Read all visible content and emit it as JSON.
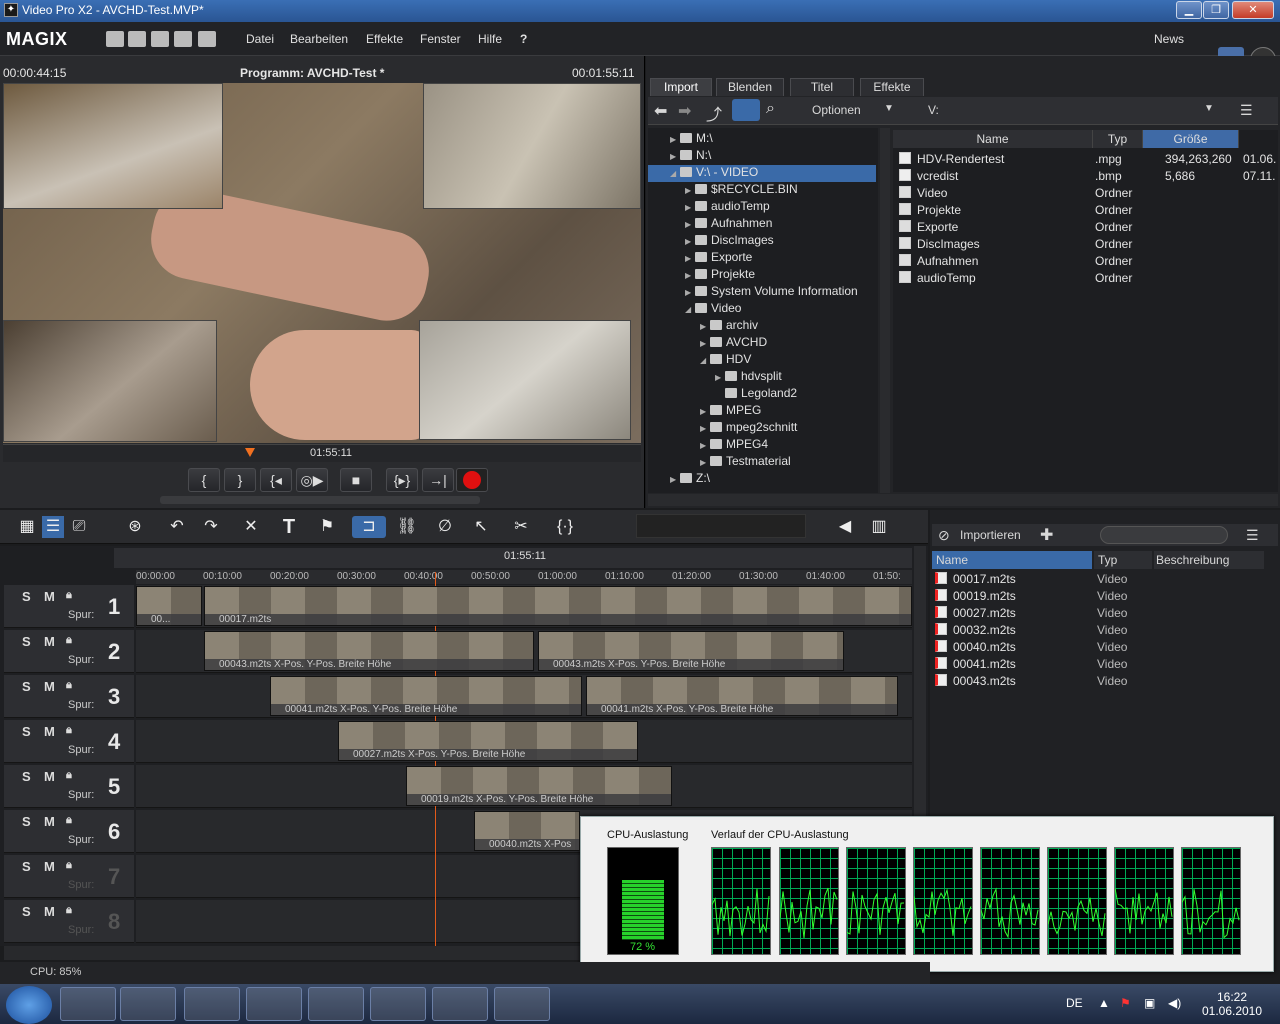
{
  "window": {
    "title": "Video Pro X2 - AVCHD-Test.MVP*",
    "minimize": "▁",
    "maximize": "❐",
    "close": "✕"
  },
  "menubar": {
    "logo": "MAGIX",
    "items": [
      "Datei",
      "Bearbeiten",
      "Effekte",
      "Fenster",
      "Hilfe"
    ],
    "help_icon": "?",
    "news": "News"
  },
  "preview": {
    "time_left": "00:00:44:15",
    "title": "Programm: AVCHD-Test *",
    "time_right": "00:01:55:11",
    "scrub_time": "01:55:11",
    "transport": [
      "{",
      "}",
      "{◂",
      "◎▶",
      "■",
      "{▸}",
      "→|"
    ]
  },
  "browser": {
    "tabs": [
      "Import",
      "Blenden",
      "Titel",
      "Effekte"
    ],
    "options": "Optionen",
    "path": "V:",
    "tree": [
      {
        "label": "M:\\",
        "level": 0,
        "arrow": "▶"
      },
      {
        "label": "N:\\",
        "level": 0,
        "arrow": "▶"
      },
      {
        "label": "V:\\ - VIDEO",
        "level": 0,
        "arrow": "◢"
      },
      {
        "label": "$RECYCLE.BIN",
        "level": 1,
        "arrow": "▶"
      },
      {
        "label": "audioTemp",
        "level": 1,
        "arrow": "▶"
      },
      {
        "label": "Aufnahmen",
        "level": 1,
        "arrow": "▶"
      },
      {
        "label": "DiscImages",
        "level": 1,
        "arrow": "▶"
      },
      {
        "label": "Exporte",
        "level": 1,
        "arrow": "▶"
      },
      {
        "label": "Projekte",
        "level": 1,
        "arrow": "▶"
      },
      {
        "label": "System Volume Information",
        "level": 1,
        "arrow": "▶"
      },
      {
        "label": "Video",
        "level": 1,
        "arrow": "◢"
      },
      {
        "label": "archiv",
        "level": 2,
        "arrow": "▶"
      },
      {
        "label": "AVCHD",
        "level": 2,
        "arrow": "▶"
      },
      {
        "label": "HDV",
        "level": 2,
        "arrow": "◢"
      },
      {
        "label": "hdvsplit",
        "level": 3,
        "arrow": "▶"
      },
      {
        "label": "Legoland2",
        "level": 3,
        "arrow": ""
      },
      {
        "label": "MPEG",
        "level": 2,
        "arrow": "▶"
      },
      {
        "label": "mpeg2schnitt",
        "level": 2,
        "arrow": "▶"
      },
      {
        "label": "MPEG4",
        "level": 2,
        "arrow": "▶"
      },
      {
        "label": "Testmaterial",
        "level": 2,
        "arrow": "▶"
      },
      {
        "label": "Z:\\",
        "level": 0,
        "arrow": "▶"
      }
    ],
    "columns": [
      "Name",
      "Typ",
      "Größe"
    ],
    "files": [
      {
        "name": "HDV-Rendertest",
        "type": ".mpg",
        "size": "394,263,260",
        "date": "01.06."
      },
      {
        "name": "vcredist",
        "type": ".bmp",
        "size": "5,686",
        "date": "07.11."
      },
      {
        "name": "Video",
        "type": "Ordner",
        "size": "",
        "date": ""
      },
      {
        "name": "Projekte",
        "type": "Ordner",
        "size": "",
        "date": ""
      },
      {
        "name": "Exporte",
        "type": "Ordner",
        "size": "",
        "date": ""
      },
      {
        "name": "DiscImages",
        "type": "Ordner",
        "size": "",
        "date": ""
      },
      {
        "name": "Aufnahmen",
        "type": "Ordner",
        "size": "",
        "date": ""
      },
      {
        "name": "audioTemp",
        "type": "Ordner",
        "size": "",
        "date": ""
      }
    ]
  },
  "timeline": {
    "position": "01:55:11",
    "ruler": [
      "00:00:00",
      "00:10:00",
      "00:20:00",
      "00:30:00",
      "00:40:00",
      "00:50:00",
      "01:00:00",
      "01:10:00",
      "01:20:00",
      "01:30:00",
      "01:40:00",
      "01:50:"
    ],
    "tracks": [
      {
        "num": "1",
        "s": "S",
        "m": "M",
        "label": "Spur:",
        "clips": [
          {
            "cap": "00..."
          },
          {
            "cap": "00017.m2ts"
          }
        ]
      },
      {
        "num": "2",
        "s": "S",
        "m": "M",
        "label": "Spur:",
        "clips": [
          {
            "cap": "00043.m2ts  X-Pos.  Y-Pos.  Breite  Höhe"
          },
          {
            "cap": "00043.m2ts  X-Pos.  Y-Pos.  Breite  Höhe"
          }
        ]
      },
      {
        "num": "3",
        "s": "S",
        "m": "M",
        "label": "Spur:",
        "clips": [
          {
            "cap": "00041.m2ts  X-Pos.  Y-Pos.  Breite  Höhe"
          },
          {
            "cap": "00041.m2ts  X-Pos.  Y-Pos.  Breite  Höhe"
          }
        ]
      },
      {
        "num": "4",
        "s": "S",
        "m": "M",
        "label": "Spur:",
        "clips": [
          {
            "cap": "00027.m2ts  X-Pos.  Y-Pos.  Breite  Höhe"
          }
        ]
      },
      {
        "num": "5",
        "s": "S",
        "m": "M",
        "label": "Spur:",
        "clips": [
          {
            "cap": "00019.m2ts  X-Pos.  Y-Pos.  Breite  Höhe"
          }
        ]
      },
      {
        "num": "6",
        "s": "S",
        "m": "M",
        "label": "Spur:",
        "clips": [
          {
            "cap": "00040.m2ts  X-Pos"
          }
        ]
      },
      {
        "num": "7",
        "s": "S",
        "m": "M",
        "label": "Spur:",
        "clips": []
      },
      {
        "num": "8",
        "s": "S",
        "m": "M",
        "label": "Spur:",
        "clips": []
      }
    ]
  },
  "import": {
    "title": "Importieren",
    "columns": [
      "Name",
      "Typ",
      "Beschreibung"
    ],
    "items": [
      {
        "name": "00017.m2ts",
        "type": "Video"
      },
      {
        "name": "00019.m2ts",
        "type": "Video"
      },
      {
        "name": "00027.m2ts",
        "type": "Video"
      },
      {
        "name": "00032.m2ts",
        "type": "Video"
      },
      {
        "name": "00040.m2ts",
        "type": "Video"
      },
      {
        "name": "00041.m2ts",
        "type": "Video"
      },
      {
        "name": "00043.m2ts",
        "type": "Video"
      }
    ]
  },
  "cpu": {
    "label": "CPU-Auslastung",
    "value": "72 %",
    "level": 0.72,
    "history_label": "Verlauf der CPU-Auslastung"
  },
  "status": {
    "cpu": "CPU: 85%"
  },
  "taskbar": {
    "lang": "DE",
    "time": "16:22",
    "date": "01.06.2010"
  }
}
